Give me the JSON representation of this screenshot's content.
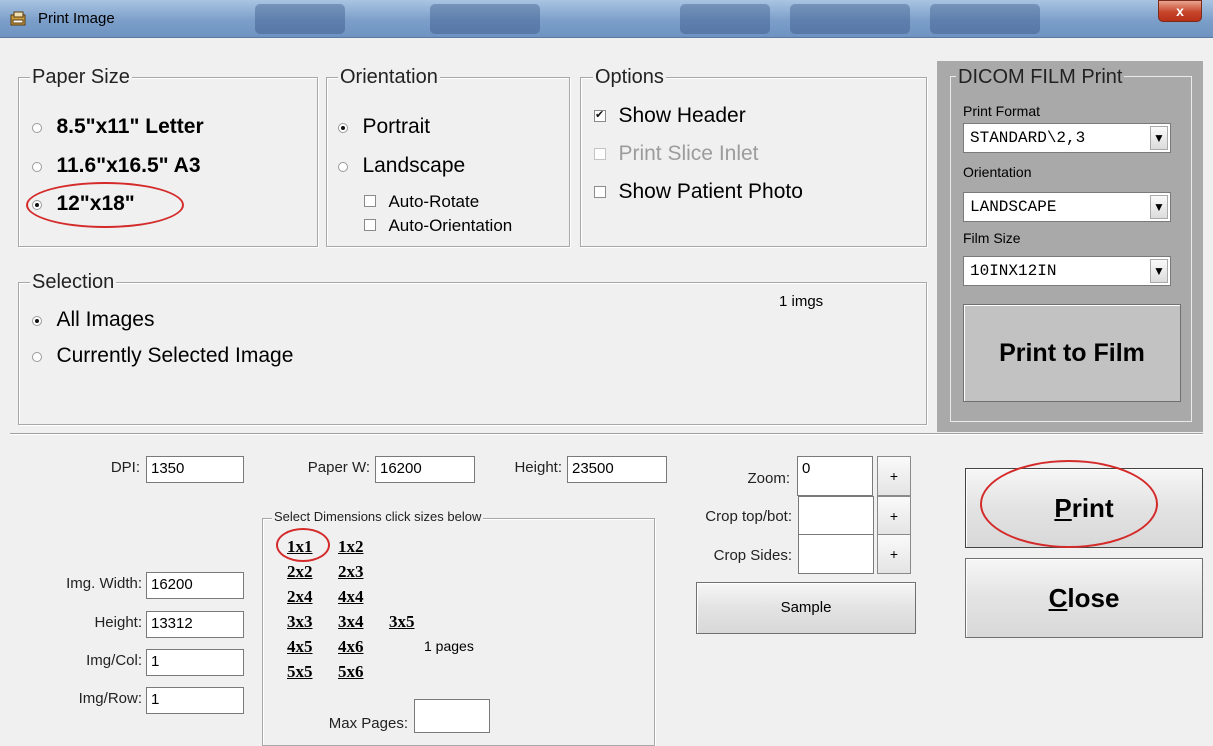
{
  "window": {
    "title": "Print Image",
    "close_glyph": "x"
  },
  "paper_size": {
    "legend": "Paper Size",
    "options": [
      {
        "label": "8.5\"x11\" Letter",
        "selected": false
      },
      {
        "label": "11.6\"x16.5\" A3",
        "selected": false
      },
      {
        "label": "12\"x18\"",
        "selected": true
      }
    ]
  },
  "orientation": {
    "legend": "Orientation",
    "portrait": "Portrait",
    "landscape": "Landscape",
    "selected": "Portrait",
    "auto_rotate": "Auto-Rotate",
    "auto_orientation": "Auto-Orientation"
  },
  "options": {
    "legend": "Options",
    "show_header": "Show Header",
    "print_slice_inlet": "Print Slice Inlet",
    "show_patient_photo": "Show Patient Photo"
  },
  "selection": {
    "legend": "Selection",
    "all_images": "All Images",
    "currently_selected": "Currently Selected Image",
    "count": "1 imgs"
  },
  "dicom": {
    "legend": "DICOM FILM Print",
    "print_format_label": "Print Format",
    "print_format_value": "STANDARD\\2,3",
    "orientation_label": "Orientation",
    "orientation_value": "LANDSCAPE",
    "film_size_label": "Film Size",
    "film_size_value": "10INX12IN",
    "print_to_film": "Print to Film"
  },
  "fields": {
    "dpi_label": "DPI:",
    "dpi_value": "1350",
    "paper_w_label": "Paper W:",
    "paper_w_value": "16200",
    "height_label": "Height:",
    "height_value": "23500",
    "img_width_label": "Img. Width:",
    "img_width_value": "16200",
    "img_height_label": "Height:",
    "img_height_value": "13312",
    "img_col_label": "Img/Col:",
    "img_col_value": "1",
    "img_row_label": "Img/Row:",
    "img_row_value": "1"
  },
  "dimensions": {
    "legend": "Select Dimensions click sizes below",
    "rows": [
      [
        "1x1",
        "1x2"
      ],
      [
        "2x2",
        "2x3"
      ],
      [
        "2x4",
        "4x4"
      ],
      [
        "3x3",
        "3x4",
        "3x5"
      ],
      [
        "4x5",
        "4x6"
      ],
      [
        "5x5",
        "5x6"
      ]
    ],
    "pages": "1 pages",
    "max_pages_label": "Max Pages:",
    "max_pages_value": ""
  },
  "zoom": {
    "zoom_label": "Zoom:",
    "zoom_value": "0",
    "crop_tb_label": "Crop top/bot:",
    "crop_tb_value": "",
    "crop_sides_label": "Crop Sides:",
    "crop_sides_value": "",
    "plus": "+",
    "sample": "Sample"
  },
  "actions": {
    "print_prefix": "P",
    "print_rest": "rint",
    "close_prefix": "C",
    "close_rest": "lose"
  },
  "colors": {
    "annotation_red": "#d42a2a",
    "dicom_panel_bg": "#a9a9a9"
  }
}
